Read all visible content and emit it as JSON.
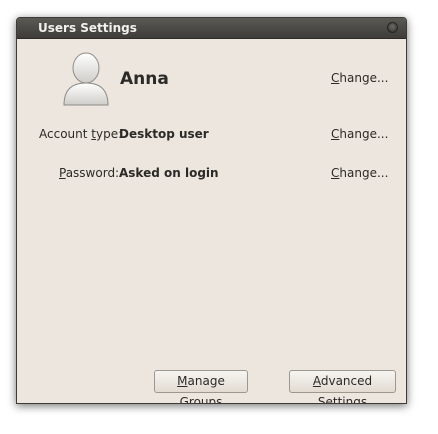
{
  "window": {
    "title": "Users Settings"
  },
  "user": {
    "name": "Anna",
    "change_label_prefix": "C",
    "change_label_rest": "hange..."
  },
  "account_type": {
    "label_prefix": "Account ",
    "label_mnemonic": "t",
    "label_rest": "ype:",
    "value": "Desktop user",
    "change_label_prefix": "C",
    "change_label_rest": "hange..."
  },
  "password": {
    "label_mnemonic": "P",
    "label_rest": "assword:",
    "value": "Asked on login",
    "change_label_prefix": "C",
    "change_label_rest": "hange..."
  },
  "buttons": {
    "manage_groups_mnemonic": "M",
    "manage_groups_rest": "anage Groups",
    "advanced_mnemonic": "A",
    "advanced_rest": "dvanced Settings"
  },
  "icons": {
    "avatar": "user-avatar-icon",
    "window_control": "window-close-icon"
  },
  "colors": {
    "window_bg": "#ede6de",
    "titlebar": "#3e3d39",
    "title_text": "#f2f1ed"
  }
}
